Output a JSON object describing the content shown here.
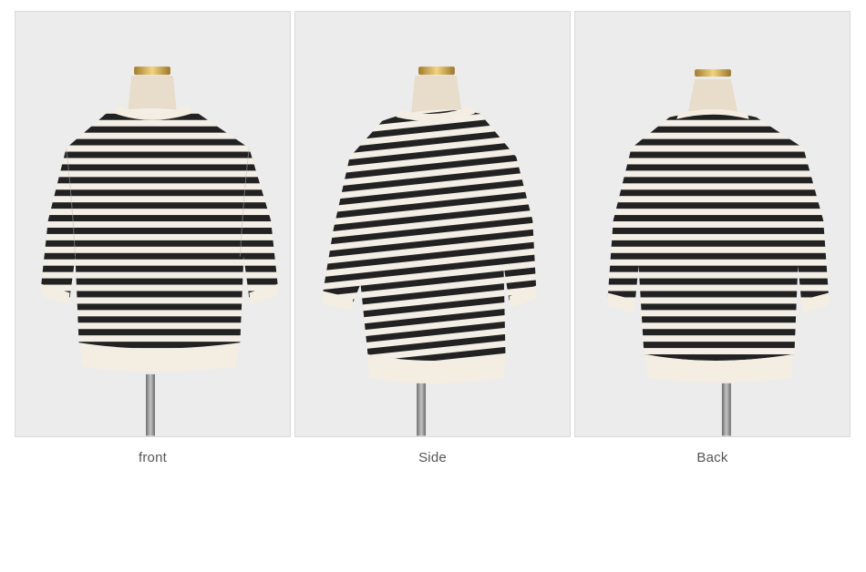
{
  "captions": {
    "front": "front",
    "side": "Side",
    "back": "Back"
  },
  "colors": {
    "backdrop": "#ececec",
    "stripe_dark": "#222222",
    "stripe_light": "#f3efe6",
    "trim": "#f4eee2",
    "mannequin": "#e8dccb",
    "gold_cap": "#c8a34a",
    "stand": "#8a8a8a"
  }
}
